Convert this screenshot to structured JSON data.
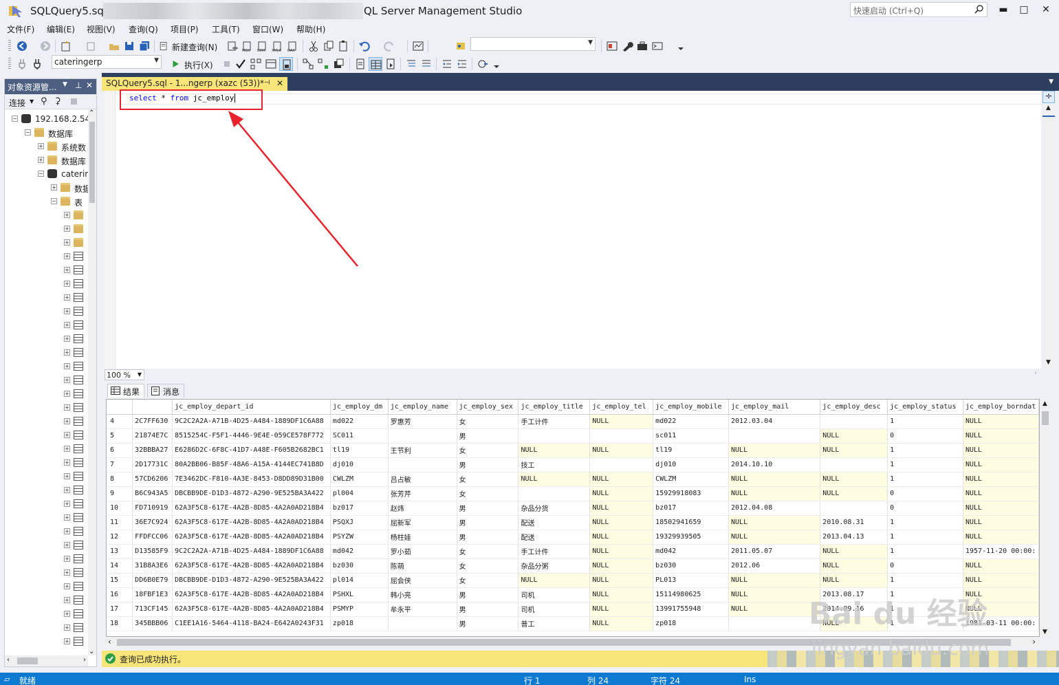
{
  "window": {
    "title": "SQLQuery5.sql",
    "app_title": "QL Server Management Studio",
    "quick_launch_placeholder": "快速启动 (Ctrl+Q)",
    "min": "▬",
    "max": "□",
    "close": "✕"
  },
  "menu": [
    "文件(F)",
    "编辑(E)",
    "视图(V)",
    "查询(Q)",
    "项目(P)",
    "工具(T)",
    "窗口(W)",
    "帮助(H)"
  ],
  "toolbar": {
    "new_query": "新建查询(N)",
    "execute": "执行(X)",
    "database": "cateringerp",
    "empty_combo": ""
  },
  "object_explorer": {
    "title": "对象资源管...",
    "connect": "连接",
    "tree": [
      {
        "label": "192.168.2.54",
        "icon": "server-icon",
        "indent": 0,
        "exp": "−"
      },
      {
        "label": "数据库",
        "icon": "folder-icon",
        "indent": 1,
        "exp": "−"
      },
      {
        "label": "系统数",
        "icon": "folder-icon",
        "indent": 2,
        "exp": "+"
      },
      {
        "label": "数据库",
        "icon": "folder-icon",
        "indent": 2,
        "exp": "+"
      },
      {
        "label": "caterin",
        "icon": "database-icon",
        "indent": 2,
        "exp": "−"
      },
      {
        "label": "数据",
        "icon": "folder-icon",
        "indent": 3,
        "exp": "+"
      },
      {
        "label": "表",
        "icon": "folder-icon",
        "indent": 3,
        "exp": "−"
      }
    ],
    "child_folders": 3,
    "child_tables": 29
  },
  "editor": {
    "tab_label": "SQLQuery5.sql - 1...ngerp (xazc (53))*",
    "sql_keyword1": "select",
    "sql_star": " * ",
    "sql_keyword2": "from",
    "sql_table": " jc_employ",
    "zoom": "100 %"
  },
  "results": {
    "tab_results": "结果",
    "tab_messages": "消息",
    "columns": [
      "",
      "",
      "jc_employ_depart_id",
      "jc_employ_dm",
      "jc_employ_name",
      "jc_employ_sex",
      "jc_employ_title",
      "jc_employ_tel",
      "jc_employ_mobile",
      "jc_employ_mail",
      "jc_employ_desc",
      "jc_employ_status",
      "jc_employ_borndat"
    ],
    "rows": [
      [
        "4",
        "2C7FF630",
        "9C2C2A2A-A71B-4D25-A484-1889DF1C6A88",
        "md022",
        "罗惠芳",
        "女",
        "手工计件",
        "NULL",
        "md022",
        "2012.03.04",
        "",
        "1",
        "NULL"
      ],
      [
        "5",
        "21874E7C",
        "8515254C-F5F1-4446-9E4E-059CE578F772",
        "SC011",
        "",
        "男",
        "",
        "",
        "sc011",
        "",
        "NULL",
        "0",
        "NULL"
      ],
      [
        "6",
        "32BBBA27",
        "E6286D2C-6F8C-41D7-A48E-F605B2682BC1",
        "tl19",
        "王节利",
        "女",
        "NULL",
        "NULL",
        "tl19",
        "NULL",
        "NULL",
        "1",
        "NULL"
      ],
      [
        "7",
        "2D17731C",
        "80A2BB06-B85F-48A6-A15A-4144EC741B8D",
        "dj010",
        "",
        "男",
        "技工",
        "",
        "dj010",
        "2014.10.10",
        "",
        "1",
        "NULL"
      ],
      [
        "8",
        "57CD6206",
        "7E3462DC-F810-4A3E-8453-D8DD89D31B00",
        "CWLZM",
        "吕占敏",
        "女",
        "NULL",
        "NULL",
        "CWLZM",
        "NULL",
        "NULL",
        "1",
        "NULL"
      ],
      [
        "9",
        "B6C943A5",
        "DBCBB9DE-D1D3-4872-A290-9E525BA3A422",
        "pl004",
        "张芳芹",
        "女",
        "",
        "NULL",
        "15929918083",
        "NULL",
        "NULL",
        "0",
        "NULL"
      ],
      [
        "10",
        "FD710919",
        "62A3F5C8-617E-4A2B-8D85-4A2A0AD218B4",
        "bz017",
        "赵炜",
        "男",
        "杂品分货",
        "NULL",
        "bz017",
        "2012.04.08",
        "",
        "0",
        "NULL"
      ],
      [
        "11",
        "36E7C924",
        "62A3F5C8-617E-4A2B-8D85-4A2A0AD218B4",
        "PSQXJ",
        "屈新军",
        "男",
        "配送",
        "NULL",
        "18502941659",
        "NULL",
        "2010.08.31",
        "1",
        "NULL"
      ],
      [
        "12",
        "FFDFCC06",
        "62A3F5C8-617E-4A2B-8D85-4A2A0AD218B4",
        "PSYZW",
        "杨柱娃",
        "男",
        "配送",
        "NULL",
        "19329939505",
        "NULL",
        "2013.04.13",
        "1",
        "NULL"
      ],
      [
        "13",
        "D13585F9",
        "9C2C2A2A-A71B-4D25-A484-1889DF1C6A88",
        "md042",
        "罗小茹",
        "女",
        "手工计件",
        "NULL",
        "md042",
        "2011.05.07",
        "NULL",
        "1",
        "1957-11-20 00:00:"
      ],
      [
        "14",
        "31B8A3E6",
        "62A3F5C8-617E-4A2B-8D85-4A2A0AD218B4",
        "bz030",
        "陈萌",
        "女",
        "杂品分粥",
        "NULL",
        "bz030",
        "2012.06",
        "NULL",
        "0",
        "NULL"
      ],
      [
        "15",
        "DD6B0E79",
        "DBCBB9DE-D1D3-4872-A290-9E525BA3A422",
        "pl014",
        "屈会侠",
        "女",
        "NULL",
        "NULL",
        "PL013",
        "NULL",
        "NULL",
        "1",
        "NULL"
      ],
      [
        "16",
        "18FBF1E3",
        "62A3F5C8-617E-4A2B-8D85-4A2A0AD218B4",
        "PSHXL",
        "韩小亮",
        "男",
        "司机",
        "NULL",
        "15114980625",
        "NULL",
        "2013.08.17",
        "1",
        "NULL"
      ],
      [
        "17",
        "713CF145",
        "62A3F5C8-617E-4A2B-8D85-4A2A0AD218B4",
        "PSMYP",
        "牟永平",
        "男",
        "司机",
        "NULL",
        "13991755948",
        "NULL",
        "2014.09.16",
        "1",
        "NULL"
      ],
      [
        "18",
        "345BBB06",
        "C1EE1A16-5464-4118-BA24-E642A0243F31",
        "zp018",
        "",
        "男",
        "普工",
        "NULL",
        "zp018",
        "",
        "NULL",
        "1",
        "1981-03-11 00:00:"
      ]
    ]
  },
  "status": {
    "exec_message": "查询已成功执行。",
    "ready": "就绪",
    "row": "行 1",
    "col": "列 24",
    "char": "字符 24",
    "ins": "Ins"
  },
  "watermark": {
    "main": "Bai du 经验",
    "sub": "jingyan.baidu.com"
  }
}
